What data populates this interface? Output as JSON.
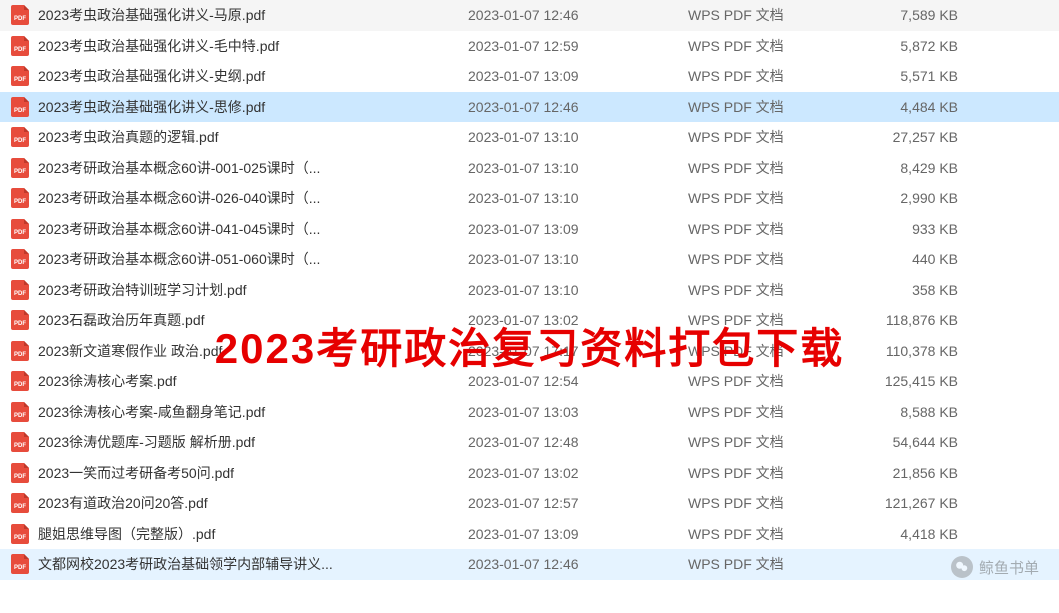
{
  "overlay_text": "2023考研政治复习资料打包下载",
  "watermark_text": "鲸鱼书单",
  "file_type_label": "WPS PDF 文档",
  "files": [
    {
      "name": "2023考虫政治基础强化讲义-马原.pdf",
      "date": "2023-01-07 12:46",
      "size": "7,589 KB",
      "selected": false
    },
    {
      "name": "2023考虫政治基础强化讲义-毛中特.pdf",
      "date": "2023-01-07 12:59",
      "size": "5,872 KB",
      "selected": false
    },
    {
      "name": "2023考虫政治基础强化讲义-史纲.pdf",
      "date": "2023-01-07 13:09",
      "size": "5,571 KB",
      "selected": false
    },
    {
      "name": "2023考虫政治基础强化讲义-思修.pdf",
      "date": "2023-01-07 12:46",
      "size": "4,484 KB",
      "selected": true
    },
    {
      "name": "2023考虫政治真题的逻辑.pdf",
      "date": "2023-01-07 13:10",
      "size": "27,257 KB",
      "selected": false
    },
    {
      "name": "2023考研政治基本概念60讲-001-025课时（...",
      "date": "2023-01-07 13:10",
      "size": "8,429 KB",
      "selected": false
    },
    {
      "name": "2023考研政治基本概念60讲-026-040课时（...",
      "date": "2023-01-07 13:10",
      "size": "2,990 KB",
      "selected": false
    },
    {
      "name": "2023考研政治基本概念60讲-041-045课时（...",
      "date": "2023-01-07 13:09",
      "size": "933 KB",
      "selected": false
    },
    {
      "name": "2023考研政治基本概念60讲-051-060课时（...",
      "date": "2023-01-07 13:10",
      "size": "440 KB",
      "selected": false
    },
    {
      "name": "2023考研政治特训班学习计划.pdf",
      "date": "2023-01-07 13:10",
      "size": "358 KB",
      "selected": false
    },
    {
      "name": "2023石磊政治历年真题.pdf",
      "date": "2023-01-07 13:02",
      "size": "118,876 KB",
      "selected": false
    },
    {
      "name": "2023新文道寒假作业 政治.pdf",
      "date": "2023-01-07 17:17",
      "size": "110,378 KB",
      "selected": false
    },
    {
      "name": "2023徐涛核心考案.pdf",
      "date": "2023-01-07 12:54",
      "size": "125,415 KB",
      "selected": false
    },
    {
      "name": "2023徐涛核心考案-咸鱼翻身笔记.pdf",
      "date": "2023-01-07 13:03",
      "size": "8,588 KB",
      "selected": false
    },
    {
      "name": "2023徐涛优题库-习题版 解析册.pdf",
      "date": "2023-01-07 12:48",
      "size": "54,644 KB",
      "selected": false
    },
    {
      "name": "2023一笑而过考研备考50问.pdf",
      "date": "2023-01-07 13:02",
      "size": "21,856 KB",
      "selected": false
    },
    {
      "name": "2023有道政治20问20答.pdf",
      "date": "2023-01-07 12:57",
      "size": "121,267 KB",
      "selected": false
    },
    {
      "name": "腿姐思维导图（完整版）.pdf",
      "date": "2023-01-07 13:09",
      "size": "4,418 KB",
      "selected": false
    },
    {
      "name": "文都网校2023考研政治基础领学内部辅导讲义...",
      "date": "2023-01-07 12:46",
      "size": "",
      "selected": false,
      "highlighted": true
    }
  ]
}
